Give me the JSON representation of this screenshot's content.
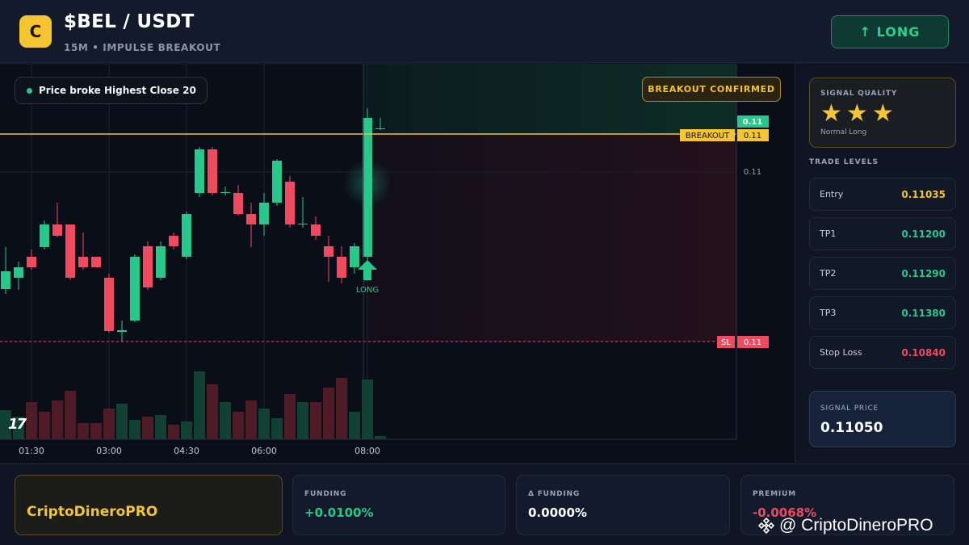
{
  "header": {
    "logo_letter": "C",
    "pair": "$BEL / USDT",
    "subtitle": "15M • IMPULSE BREAKOUT",
    "action_label": "↑ LONG"
  },
  "chart": {
    "status_text": "Price broke Highest Close 20",
    "confirm_badge": "BREAKOUT CONFIRMED",
    "last_price_label": "0.11",
    "breakout_tag": "BREAKOUT",
    "breakout_value": "0.11",
    "axis_price_label": "0.11",
    "sl_tag": "SL",
    "sl_value": "0.11",
    "signal_marker_label": "LONG",
    "time_labels": [
      "01:30",
      "03:00",
      "04:30",
      "06:00",
      "08:00"
    ],
    "tv_logo": "17",
    "colors": {
      "up": "#27c98a",
      "down": "#ef4a5f",
      "breakout": "#f5c431"
    }
  },
  "sidebar": {
    "quality_label": "SIGNAL QUALITY",
    "stars": 3,
    "quality_type": "Normal Long",
    "levels_title": "TRADE LEVELS",
    "levels": [
      {
        "name": "Entry",
        "value": "0.11035",
        "color": "#f5c431"
      },
      {
        "name": "TP1",
        "value": "0.11200",
        "color": "#27c98a"
      },
      {
        "name": "TP2",
        "value": "0.11290",
        "color": "#27c98a"
      },
      {
        "name": "TP3",
        "value": "0.11380",
        "color": "#27c98a"
      },
      {
        "name": "Stop Loss",
        "value": "0.10840",
        "color": "#ef4a5f"
      }
    ],
    "signal_price_label": "SIGNAL PRICE",
    "signal_price": "0.11050"
  },
  "footer": {
    "brand": "CriptoDineroPRO",
    "stats": [
      {
        "label": "FUNDING",
        "value": "+0.0100%",
        "color": "#27c98a"
      },
      {
        "label": "Δ FUNDING",
        "value": "0.0000%",
        "color": "#ffffff"
      },
      {
        "label": "PREMIUM",
        "value": "-0.0068%",
        "color": "#ef4a5f"
      }
    ],
    "watermark": "@ CriptoDineroPRO"
  }
}
